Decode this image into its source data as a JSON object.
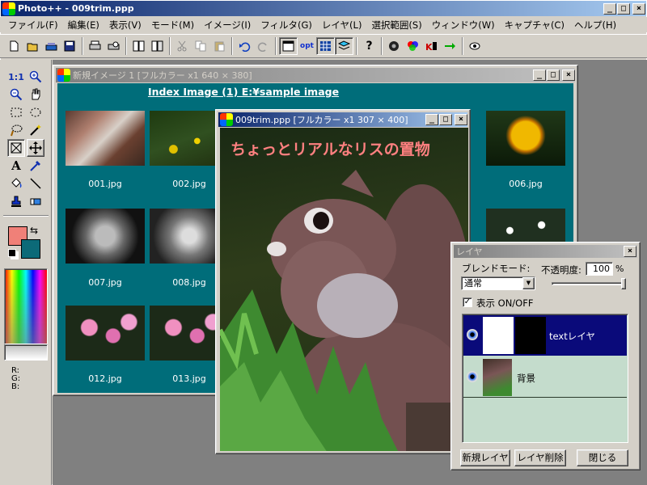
{
  "app": {
    "title": "Photo++ - 009trim.ppp"
  },
  "menu": [
    "ファイル(F)",
    "編集(E)",
    "表示(V)",
    "モード(M)",
    "イメージ(I)",
    "フィルタ(G)",
    "レイヤ(L)",
    "選択範囲(S)",
    "ウィンドウ(W)",
    "キャプチャ(C)",
    "ヘルプ(H)"
  ],
  "toolbar": {
    "opt_label": "opt"
  },
  "toolbox": {
    "zoom_label": "1:1",
    "text_tool": "A",
    "rgb_labels": [
      "R:",
      "G:",
      "B:"
    ]
  },
  "colors": {
    "foreground": "#f08078",
    "background": "#0c6a78",
    "accent": "#0a246a",
    "panel": "#d4d0c8",
    "teal": "#006d7a",
    "layer_bg": "#c4dccc"
  },
  "index_window": {
    "title": "新規イメージ 1 [フルカラー x1  640 × 380]",
    "heading": "Index Image (1)  E:¥sample image",
    "thumbnails": [
      {
        "label": "001.jpg"
      },
      {
        "label": "002.jpg"
      },
      {
        "label": "006.jpg"
      },
      {
        "label": "007.jpg"
      },
      {
        "label": "008.jpg"
      },
      {
        "label": "012.jpg"
      },
      {
        "label": "013.jpg"
      }
    ]
  },
  "photo_window": {
    "title": "009trim.ppp [フルカラー x1  307 × 400]",
    "caption": "ちょっとリアルなリスの置物"
  },
  "layer_panel": {
    "title": "レイヤ",
    "blend_label": "ブレンドモード:",
    "blend_value": "通常",
    "opacity_label": "不透明度:",
    "opacity_value": "100",
    "opacity_unit": "%",
    "opacity_level": 1.0,
    "show_label": "表示 ON/OFF",
    "show_checked": true,
    "layers": [
      {
        "name": "textレイヤ",
        "selected": true
      },
      {
        "name": "背景",
        "selected": false
      }
    ],
    "buttons": {
      "new": "新規レイヤ",
      "delete": "レイヤ削除",
      "close": "閉じる"
    }
  },
  "window_buttons": {
    "minimize": "_",
    "maximize": "□",
    "close": "×"
  }
}
